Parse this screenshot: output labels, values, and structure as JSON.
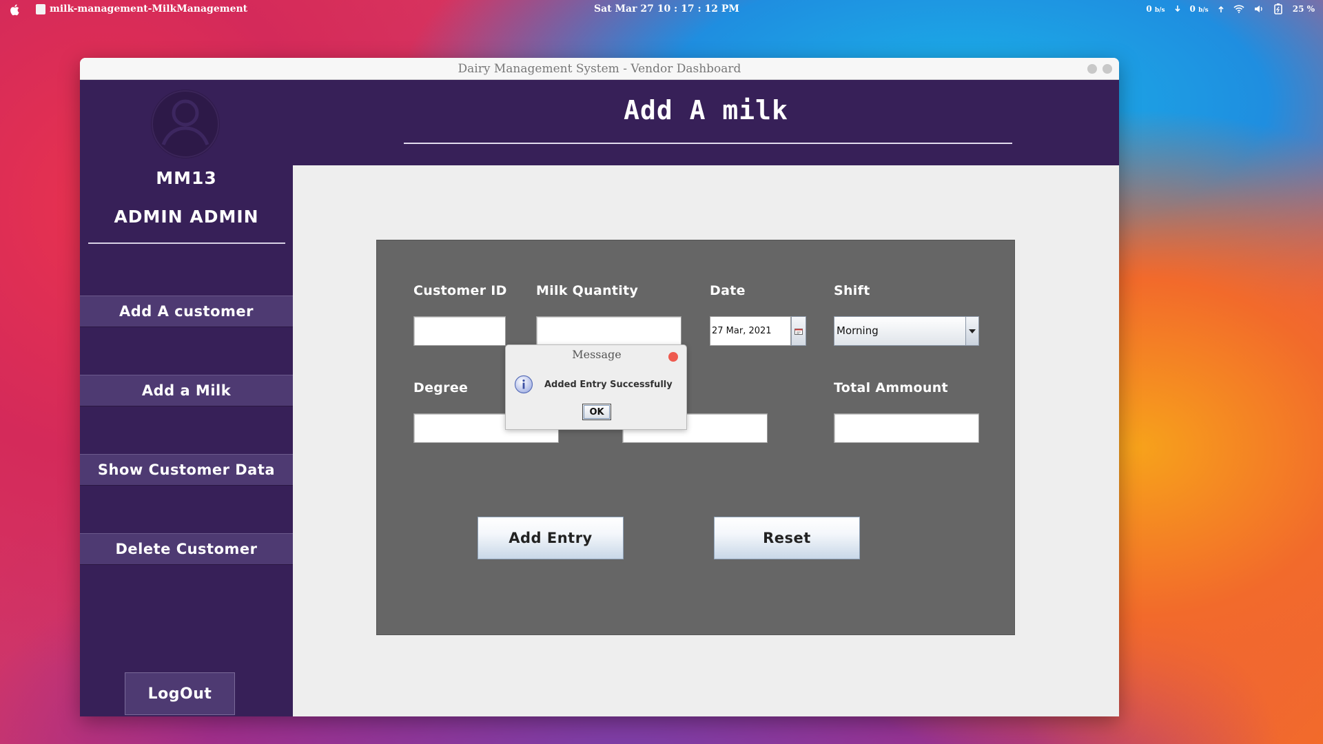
{
  "menubar": {
    "app_title": "milk-management-MilkManagement",
    "clock": "Sat Mar 27  10 : 17 : 12 PM",
    "net_down_value": "0",
    "net_down_unit": "b/s",
    "net_up_value": "0",
    "net_up_unit": "b/s",
    "battery": "25 %"
  },
  "window": {
    "title": "Dairy Management System - Vendor Dashboard"
  },
  "sidebar": {
    "user_id": "MM13",
    "user_name": "ADMIN ADMIN",
    "nav": [
      {
        "label": "Add A customer"
      },
      {
        "label": "Add a Milk"
      },
      {
        "label": "Show Customer Data"
      },
      {
        "label": "Delete Customer"
      }
    ],
    "logout_label": "LogOut"
  },
  "header": {
    "title": "Add A milk"
  },
  "form": {
    "customer_id_label": "Customer ID",
    "customer_id_value": "",
    "milk_quantity_label": "Milk Quantity",
    "milk_quantity_value": "",
    "date_label": "Date",
    "date_value": "27 Mar, 2021",
    "shift_label": "Shift",
    "shift_value": "Morning",
    "degree_label": "Degree",
    "degree_value": "",
    "fat_value": "",
    "total_amount_label": "Total Ammount",
    "total_amount_value": "",
    "add_entry_label": "Add Entry",
    "reset_label": "Reset"
  },
  "dialog": {
    "title": "Message",
    "message": "Added Entry Successfully",
    "ok_label": "OK"
  },
  "colors": {
    "sidebar_bg": "#372058",
    "nav_button_bg": "#4e3a72",
    "form_panel_bg": "#666666",
    "content_bg": "#eeeeee",
    "dialog_close": "#ee5a4f"
  }
}
